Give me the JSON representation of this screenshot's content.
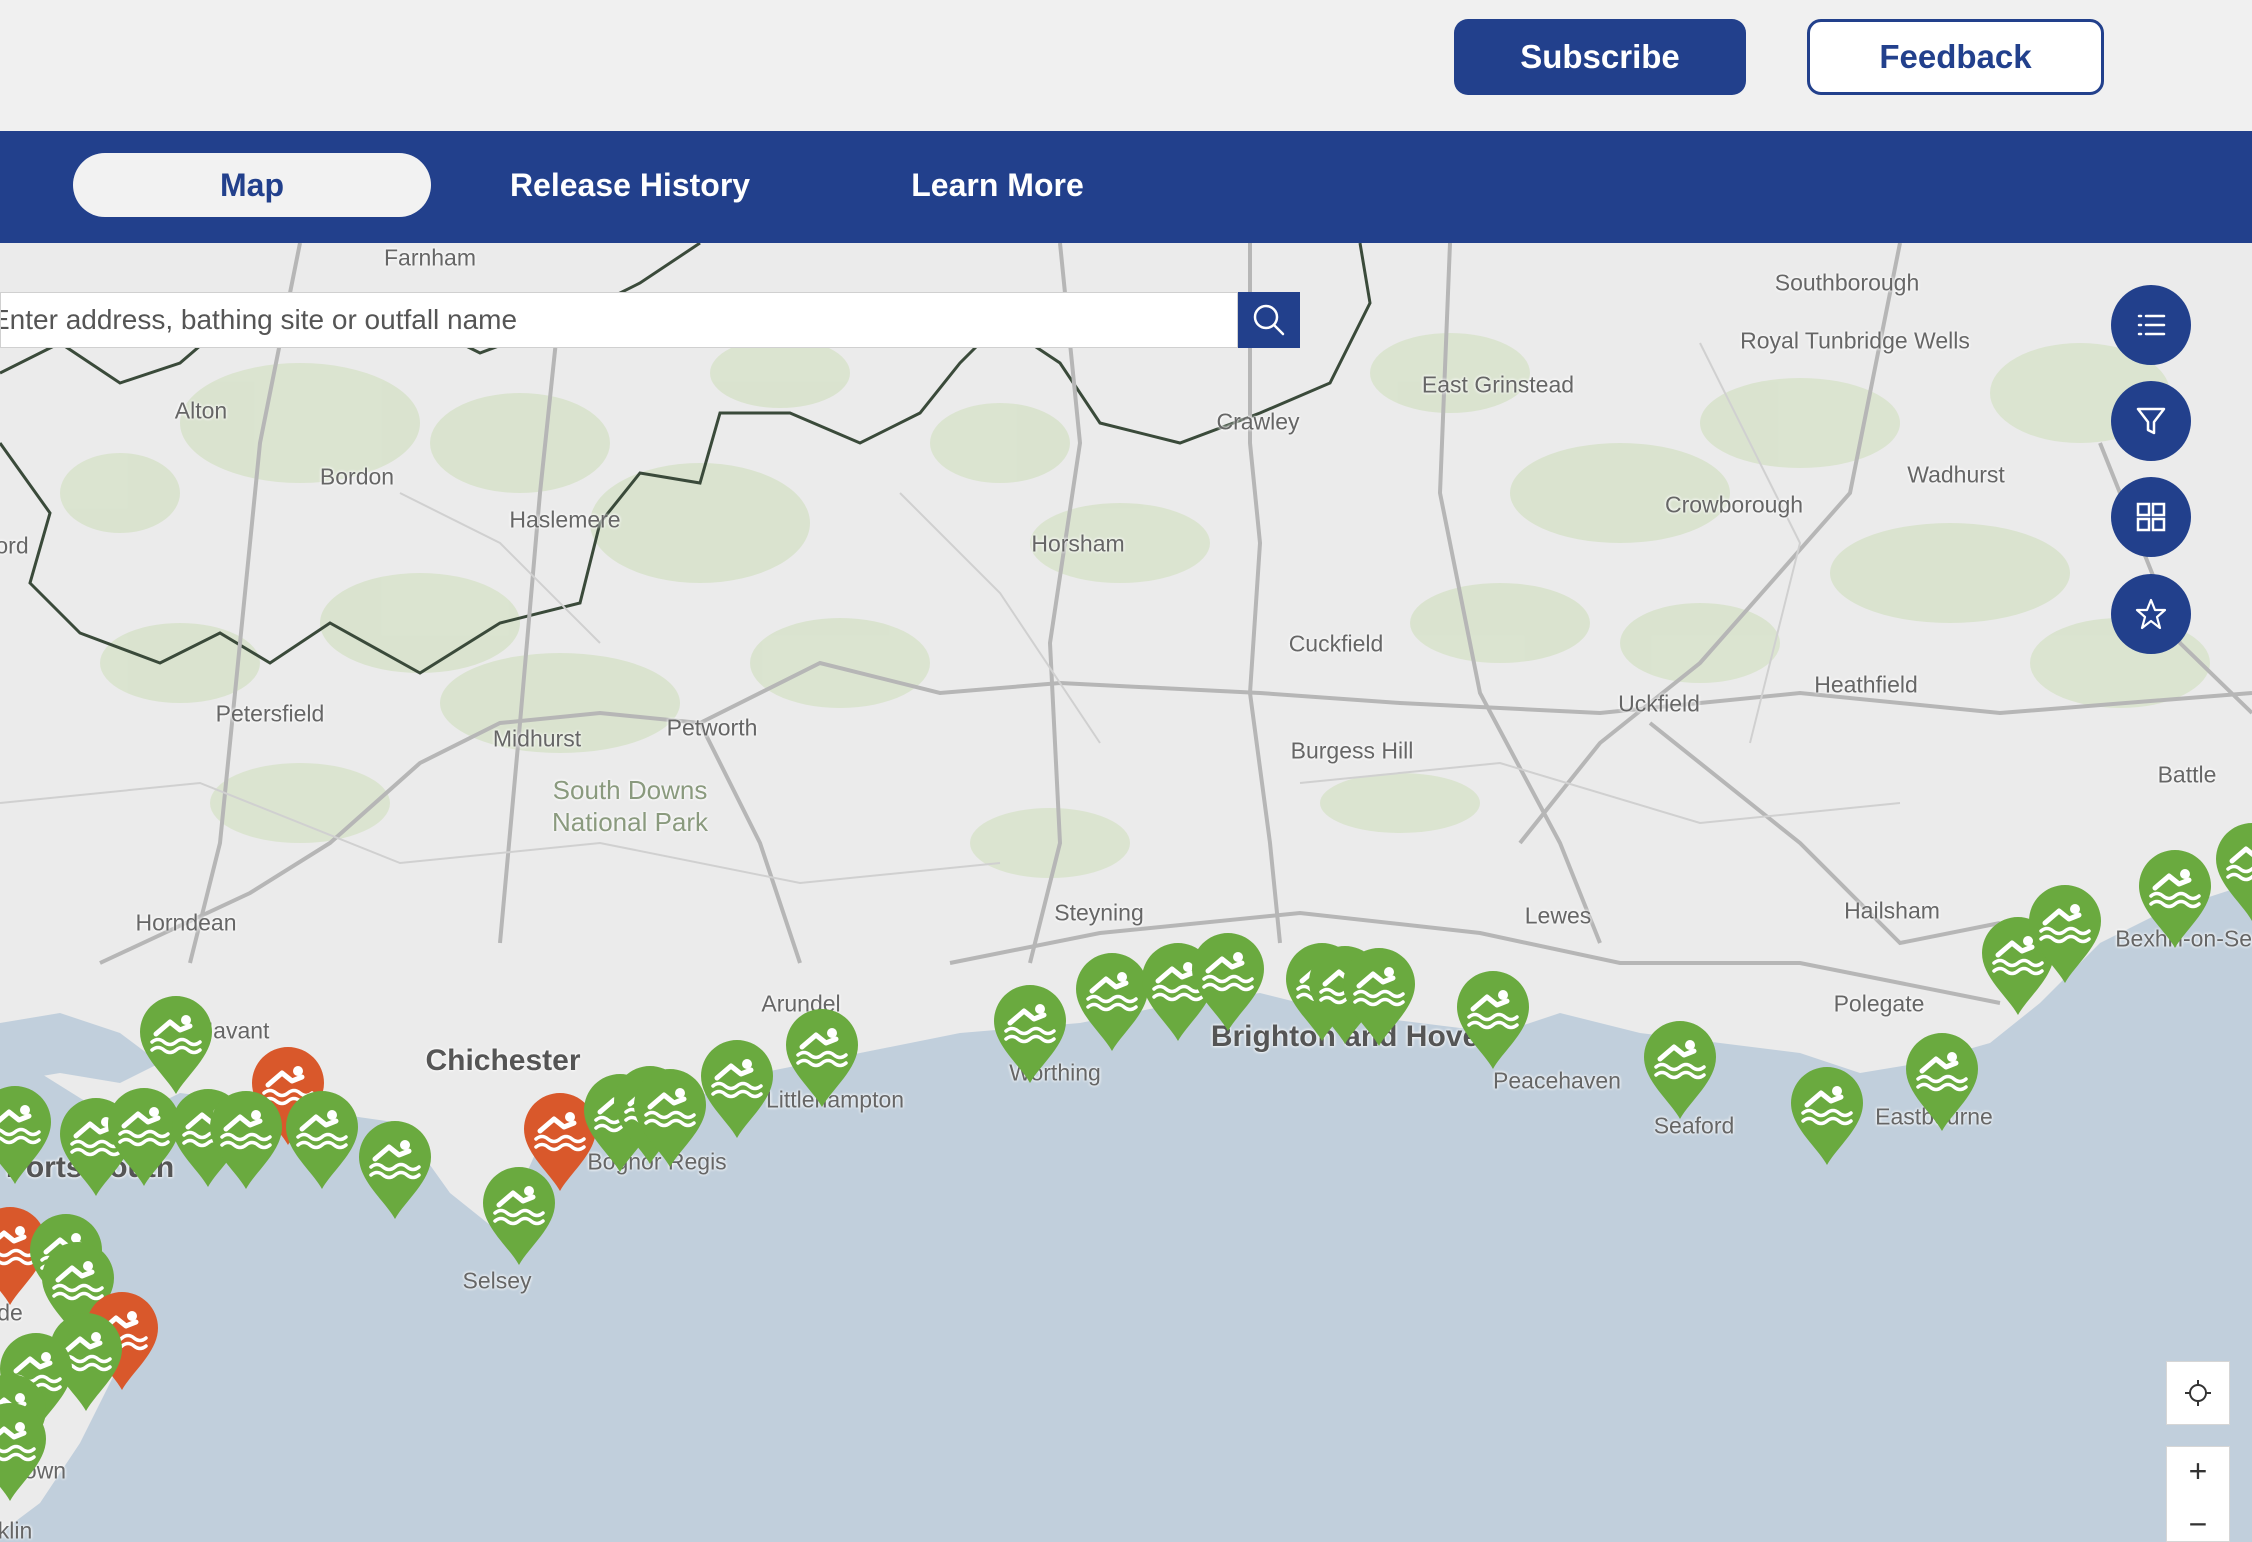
{
  "header": {
    "subscribe_label": "Subscribe",
    "feedback_label": "Feedback"
  },
  "nav": {
    "tabs": [
      {
        "label": "Map",
        "active": true
      },
      {
        "label": "Release History",
        "active": false
      },
      {
        "label": "Learn More",
        "active": false
      }
    ]
  },
  "search": {
    "placeholder": "Enter address, bathing site or outfall name"
  },
  "map_controls": {
    "side_buttons": [
      "list-icon",
      "filter-icon",
      "grid-icon",
      "star-icon"
    ],
    "locate_icon": "crosshair-icon",
    "zoom_in": "+",
    "zoom_out": "−"
  },
  "colors": {
    "brand": "#22408c",
    "pin_normal": "#6aaa3f",
    "pin_alert": "#d9582b",
    "sea": "#c1cfdc",
    "land": "#ebebeb",
    "woodland": "#d9e3cd"
  },
  "places": {
    "farnham": "Farnham",
    "southborough": "Southborough",
    "royal_tunbridge_wells": "Royal Tunbridge Wells",
    "east_grinstead": "East Grinstead",
    "crawley": "Crawley",
    "alton": "Alton",
    "bordon": "Bordon",
    "haslemere": "Haslemere",
    "wadhurst": "Wadhurst",
    "crowborough": "Crowborough",
    "horsham": "Horsham",
    "ford": "ord",
    "cuckfield": "Cuckfield",
    "heathfield": "Heathfield",
    "uckfield": "Uckfield",
    "petersfield": "Petersfield",
    "midhurst": "Midhurst",
    "petworth": "Petworth",
    "burgess_hill": "Burgess Hill",
    "battle": "Battle",
    "south_downs": "South Downs National Park",
    "horndean": "Horndean",
    "steyning": "Steyning",
    "lewes": "Lewes",
    "hailsham": "Hailsham",
    "bexhill": "Bexhill-on-Sea",
    "arundel": "Arundel",
    "polegate": "Polegate",
    "havant": "Havant",
    "chichester": "Chichester",
    "brighton": "Brighton and Hove",
    "peacehaven": "Peacehaven",
    "worthing": "Worthing",
    "littlehampton": "Littlehampton",
    "portsmouth": "Portsmouth",
    "bognor": "Bognor Regis",
    "eastbourne": "Eastbourne",
    "seaford": "Seaford",
    "selsey": "Selsey",
    "ryde": "de",
    "sandown": "own",
    "shanklin": "klin"
  },
  "pins": {
    "normal": 44,
    "alert": 4
  }
}
